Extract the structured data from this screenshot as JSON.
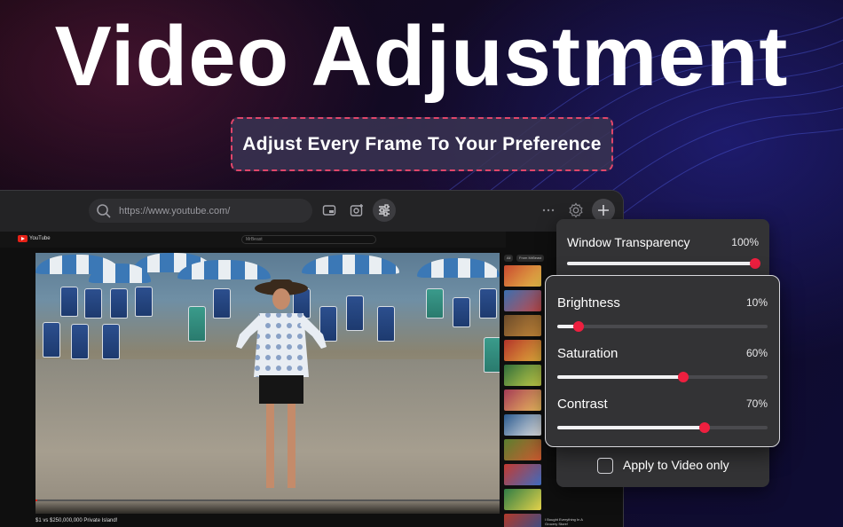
{
  "headline": "Video Adjustment",
  "subtitle": "Adjust Every Frame To Your Preference",
  "browser": {
    "url": "https://www.youtube.com/",
    "icons": [
      "search-icon",
      "pip-icon",
      "screenshot-icon",
      "adjust-icon",
      "more-icon",
      "gear-icon",
      "plus-icon"
    ]
  },
  "youtube": {
    "logo": "YouTube",
    "search_text": "MrBeast",
    "video_title": "$1 vs $250,000,000 Private Island!",
    "sidebar_chips": [
      "All",
      "From MrBeast"
    ],
    "side_item_text": "I Bought Everything In A Grocery Store!"
  },
  "panel": {
    "window_transparency": {
      "label": "Window Transparency",
      "value_text": "100%",
      "value": 100
    },
    "brightness": {
      "label": "Brightness",
      "value_text": "10%",
      "value": 10
    },
    "saturation": {
      "label": "Saturation",
      "value_text": "60%",
      "value": 60
    },
    "contrast": {
      "label": "Contrast",
      "value_text": "70%",
      "value": 70
    },
    "apply_label": "Apply to Video only",
    "apply_checked": false
  },
  "colors": {
    "accent": "#ee1f3f",
    "panel": "#333335",
    "dash_border": "#e0466b"
  }
}
